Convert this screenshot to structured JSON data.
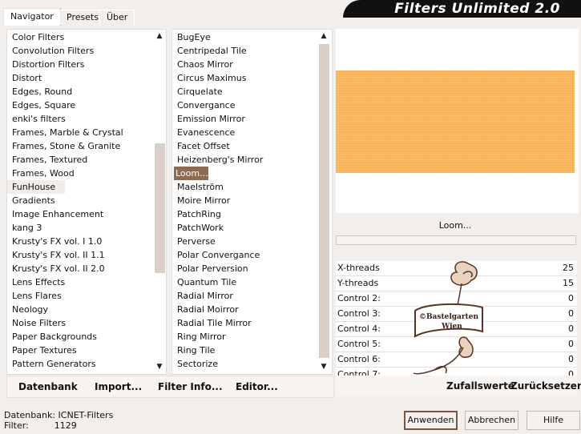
{
  "title": "Filters Unlimited 2.0",
  "tabs": [
    "Navigator",
    "Presets",
    "Über"
  ],
  "categories": [
    "Color Filters",
    "Convolution Filters",
    "Distortion Filters",
    "Distort",
    "Edges, Round",
    "Edges, Square",
    "enki's filters",
    "Frames, Marble & Crystal",
    "Frames, Stone & Granite",
    "Frames, Textured",
    "Frames, Wood",
    "FunHouse",
    "Gradients",
    "Image Enhancement",
    "kang 3",
    "Krusty's FX vol. I 1.0",
    "Krusty's FX vol. II 1.1",
    "Krusty's FX vol. II 2.0",
    "Lens Effects",
    "Lens Flares",
    "Neology",
    "Noise Filters",
    "Paper Backgrounds",
    "Paper Textures",
    "Pattern Generators"
  ],
  "selected_category": "FunHouse",
  "filters": [
    "BugEye",
    "Centripedal Tile",
    "Chaos Mirror",
    "Circus Maximus",
    "Cirquelate",
    "Convergance",
    "Emission Mirror",
    "Evanescence",
    "Facet Offset",
    "Heizenberg's Mirror",
    "Loom...",
    "Maelström",
    "Moire Mirror",
    "PatchRing",
    "PatchWork",
    "Perverse",
    "Polar Convergance",
    "Polar Perversion",
    "Quantum Tile",
    "Radial Mirror",
    "Radial Moirror",
    "Radial Tile Mirror",
    "Ring Mirror",
    "Ring Tile",
    "Sectorize"
  ],
  "selected_filter": "Loom...",
  "preview_filter_name": "Loom...",
  "controls": [
    {
      "label": "X-threads",
      "value": "25"
    },
    {
      "label": "Y-threads",
      "value": "15"
    },
    {
      "label": "Control 2:",
      "value": "0"
    },
    {
      "label": "Control 3:",
      "value": "0"
    },
    {
      "label": "Control 4:",
      "value": "0"
    },
    {
      "label": "Control 5:",
      "value": "0"
    },
    {
      "label": "Control 6:",
      "value": "0"
    },
    {
      "label": "Control 7:",
      "value": "0"
    }
  ],
  "bottom_links": {
    "database": "Datenbank",
    "import": "Import...",
    "filter_info": "Filter Info...",
    "editor": "Editor..."
  },
  "randomize": "Zufallswerte",
  "reset": "Zurücksetzen",
  "status": {
    "db_label": "Datenbank:",
    "db_value": "ICNET-Filters",
    "filter_label": "Filter:",
    "filter_value": "1129"
  },
  "buttons": {
    "apply": "Anwenden",
    "cancel": "Abbrechen",
    "help": "Hilfe"
  },
  "watermark": {
    "line1": "©Bastelgarten",
    "line2": "Wien"
  },
  "colors": {
    "accent": "#8d6b52",
    "preview": "#fbb85e",
    "titlebar": "#111111"
  }
}
